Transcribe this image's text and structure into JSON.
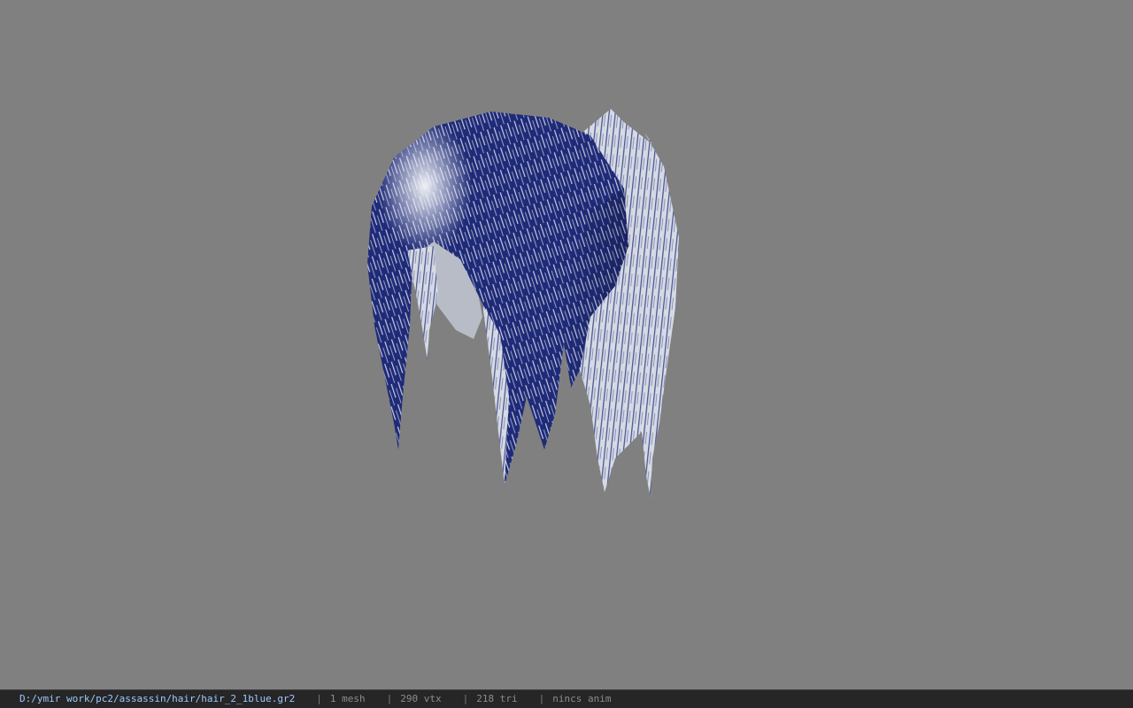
{
  "viewer": {
    "background_color": "#808080",
    "model": {
      "name": "hair-model",
      "primary_color": "#1f2b78",
      "highlight_color": "#d9dde6"
    }
  },
  "statusbar": {
    "file_path": "D:/ymir work/pc2/assassin/hair/hair_2_1blue.gr2",
    "separator": "|",
    "mesh_count": "1 mesh",
    "vertex_count": "290 vtx",
    "triangle_count": "218 tri",
    "anim_status": "nincs anim"
  }
}
